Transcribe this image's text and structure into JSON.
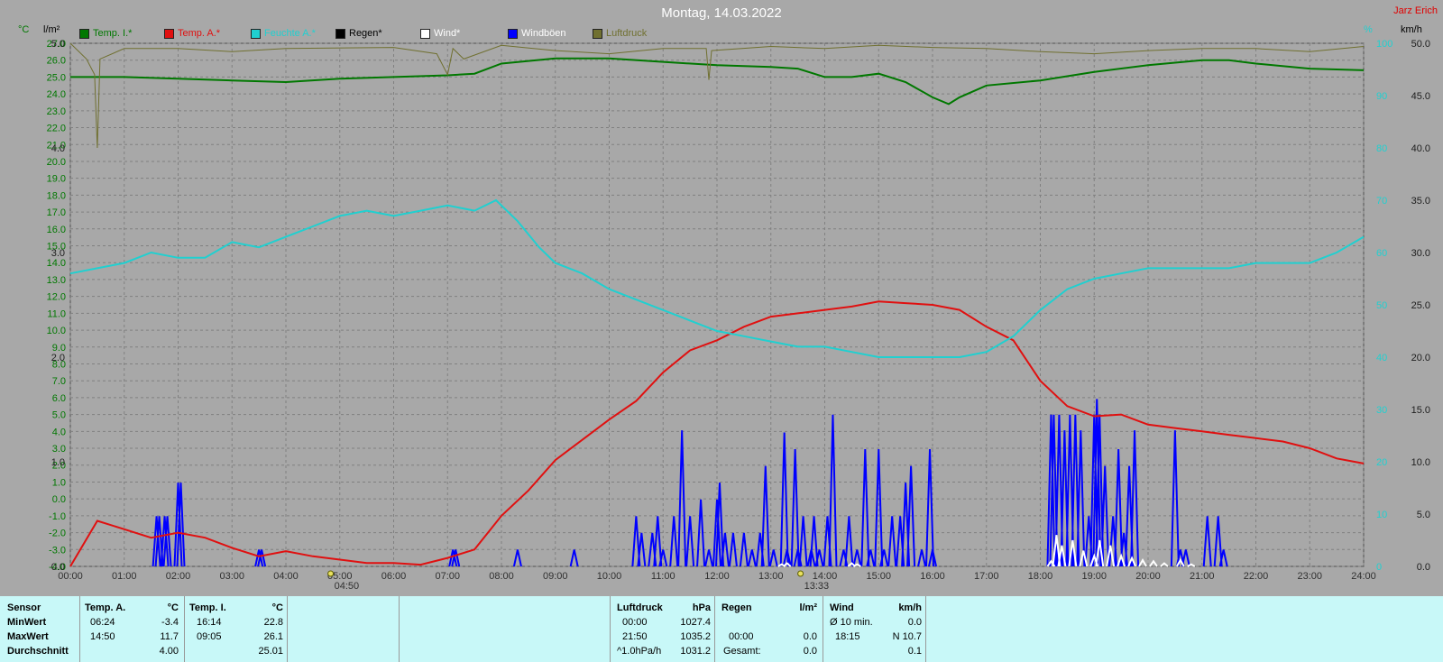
{
  "title": "Montag, 14.03.2022",
  "author": "Jarz Erich",
  "colors": {
    "temp_inside": "#007800",
    "temp_outside": "#e01010",
    "humidity": "#20d0d0",
    "rain": "#000000",
    "wind": "#ffffff",
    "gusts": "#0000ff",
    "pressure": "#707030",
    "axis_left": "#007800",
    "axis_right": "#20d0d0"
  },
  "legend": [
    {
      "label": "Temp. I.*",
      "color": "#007800"
    },
    {
      "label": "Temp. A.*",
      "color": "#e01010"
    },
    {
      "label": "Feuchte A.*",
      "color": "#20d0d0"
    },
    {
      "label": "Regen*",
      "color": "#000000"
    },
    {
      "label": "Wind*",
      "color": "#ffffff"
    },
    {
      "label": "Windböen",
      "color": "#0000ff"
    },
    {
      "label": "Luftdruck",
      "color": "#707030"
    }
  ],
  "units": {
    "temp": "°C",
    "rain": "l/m²",
    "humidity": "%",
    "wind": "km/h"
  },
  "chart_data": {
    "type": "line",
    "title": "Montag, 14.03.2022",
    "x_ticks": [
      "00:00",
      "01:00",
      "02:00",
      "03:00",
      "04:00",
      "05:00",
      "06:00",
      "07:00",
      "08:00",
      "09:00",
      "10:00",
      "11:00",
      "12:00",
      "13:00",
      "14:00",
      "15:00",
      "16:00",
      "17:00",
      "18:00",
      "19:00",
      "20:00",
      "21:00",
      "22:00",
      "23:00",
      "24:00"
    ],
    "x_range": [
      0,
      24
    ],
    "y_temp_ticks": [
      "27.0",
      "26.0",
      "25.0",
      "24.0",
      "23.0",
      "22.0",
      "21.0",
      "20.0",
      "19.0",
      "18.0",
      "17.0",
      "16.0",
      "15.0",
      "14.0",
      "13.0",
      "12.0",
      "11.0",
      "10.0",
      "9.0",
      "8.0",
      "7.0",
      "6.0",
      "5.0",
      "4.0",
      "3.0",
      "2.0",
      "1.0",
      "0.0",
      "-1.0",
      "-2.0",
      "-3.0",
      "-4.0"
    ],
    "y_temp_range": [
      -4,
      27
    ],
    "y_rain_ticks": [
      "5.0",
      "4.0",
      "3.0",
      "2.0",
      "1.0",
      "0.0"
    ],
    "y_rain_range": [
      0,
      5
    ],
    "y_humidity_ticks": [
      "100",
      "90",
      "80",
      "70",
      "60",
      "50",
      "40",
      "30",
      "20",
      "10",
      "0"
    ],
    "y_humidity_range": [
      0,
      100
    ],
    "y_wind_ticks": [
      "50.0",
      "45.0",
      "40.0",
      "35.0",
      "30.0",
      "25.0",
      "20.0",
      "15.0",
      "10.0",
      "5.0",
      "0.0"
    ],
    "y_wind_range": [
      0,
      50
    ],
    "markers": [
      {
        "x": 4.83,
        "label": "04:50",
        "icon": "sunrise-icon"
      },
      {
        "x": 13.55,
        "label": "13:33",
        "icon": "moon-icon"
      }
    ],
    "series": [
      {
        "name": "Temp. I.*",
        "axis": "temp",
        "color": "#007800",
        "x": [
          0,
          1,
          2,
          3,
          4,
          5,
          6,
          7,
          7.5,
          8,
          9,
          10,
          11,
          12,
          13,
          13.5,
          14,
          14.5,
          15,
          15.5,
          16,
          16.3,
          16.5,
          17,
          18,
          19,
          20,
          21,
          21.5,
          22,
          23,
          24
        ],
        "y": [
          25.0,
          25.0,
          24.9,
          24.8,
          24.7,
          24.9,
          25.0,
          25.1,
          25.2,
          25.8,
          26.1,
          26.1,
          25.9,
          25.7,
          25.6,
          25.5,
          25.0,
          25.0,
          25.2,
          24.7,
          23.8,
          23.4,
          23.8,
          24.5,
          24.8,
          25.3,
          25.7,
          26.0,
          26.0,
          25.8,
          25.5,
          25.4
        ]
      },
      {
        "name": "Temp. A.*",
        "axis": "temp",
        "color": "#e01010",
        "x": [
          0,
          0.5,
          1,
          1.5,
          2,
          2.5,
          3,
          3.5,
          4,
          4.5,
          5,
          5.5,
          6,
          6.5,
          7,
          7.5,
          8,
          8.5,
          9,
          9.5,
          10,
          10.5,
          11,
          11.5,
          12,
          12.5,
          13,
          13.5,
          14,
          14.5,
          15,
          15.5,
          16,
          16.5,
          17,
          17.5,
          18,
          18.5,
          19,
          19.5,
          20,
          20.5,
          21,
          21.5,
          22,
          22.5,
          23,
          23.5,
          24
        ],
        "y": [
          -4.0,
          -1.3,
          -1.8,
          -2.3,
          -2.0,
          -2.3,
          -2.9,
          -3.4,
          -3.1,
          -3.4,
          -3.6,
          -3.8,
          -3.8,
          -3.9,
          -3.5,
          -3.0,
          -1.0,
          0.5,
          2.3,
          3.5,
          4.7,
          5.8,
          7.5,
          8.8,
          9.4,
          10.2,
          10.8,
          11.0,
          11.2,
          11.4,
          11.7,
          11.6,
          11.5,
          11.2,
          10.2,
          9.4,
          7.0,
          5.5,
          4.9,
          5.0,
          4.4,
          4.2,
          4.0,
          3.8,
          3.6,
          3.4,
          3.0,
          2.4,
          2.1
        ]
      },
      {
        "name": "Feuchte A.*",
        "axis": "humidity",
        "color": "#20d0d0",
        "x": [
          0,
          0.5,
          1,
          1.5,
          2,
          2.5,
          3,
          3.5,
          4,
          4.5,
          5,
          5.5,
          6,
          6.5,
          7,
          7.5,
          7.9,
          8.3,
          8.7,
          9,
          9.5,
          10,
          10.5,
          11,
          11.5,
          12,
          12.5,
          13,
          13.5,
          14,
          14.5,
          15,
          15.5,
          16,
          16.5,
          17,
          17.5,
          18,
          18.5,
          19,
          19.5,
          20,
          20.5,
          21,
          21.5,
          22,
          22.5,
          23,
          23.5,
          24
        ],
        "y": [
          56,
          57,
          58,
          60,
          59,
          59,
          62,
          61,
          63,
          65,
          67,
          68,
          67,
          68,
          69,
          68,
          70,
          66,
          61,
          58,
          56,
          53,
          51,
          49,
          47,
          45,
          44,
          43,
          42,
          42,
          41,
          40,
          40,
          40,
          40,
          41,
          44,
          49,
          53,
          55,
          56,
          57,
          57,
          57,
          57,
          58,
          58,
          58,
          60,
          63
        ]
      },
      {
        "name": "Luftdruck",
        "axis": "rain",
        "color": "#707030",
        "x": [
          0,
          0.3,
          0.45,
          0.5,
          0.55,
          1,
          2,
          3,
          4,
          6,
          6.8,
          7.0,
          7.1,
          7.3,
          8,
          9,
          10,
          11,
          11.8,
          11.85,
          11.9,
          13,
          14,
          15,
          16,
          17,
          18,
          19,
          20,
          21,
          22,
          23,
          24
        ],
        "y": [
          5.0,
          4.85,
          4.7,
          4.0,
          4.85,
          4.95,
          4.95,
          4.92,
          4.95,
          4.96,
          4.9,
          4.7,
          4.95,
          4.85,
          4.98,
          4.93,
          4.9,
          4.95,
          4.95,
          4.65,
          4.93,
          4.97,
          4.95,
          4.98,
          4.96,
          4.95,
          4.92,
          4.9,
          4.93,
          4.95,
          4.95,
          4.92,
          4.97
        ]
      }
    ],
    "bars": [
      {
        "name": "Windböen",
        "axis": "wind",
        "color": "#0000ff",
        "x": [
          1.6,
          1.65,
          1.75,
          1.8,
          2.0,
          2.05,
          3.5,
          3.55,
          7.1,
          7.15,
          8.3,
          9.35,
          10.5,
          10.6,
          10.8,
          10.9,
          11.0,
          11.2,
          11.35,
          11.5,
          11.7,
          11.85,
          12.0,
          12.05,
          12.15,
          12.3,
          12.5,
          12.65,
          12.8,
          12.9,
          13.05,
          13.25,
          13.3,
          13.45,
          13.5,
          13.6,
          13.75,
          13.8,
          13.9,
          14.05,
          14.15,
          14.35,
          14.45,
          14.6,
          14.75,
          14.85,
          15.0,
          15.1,
          15.25,
          15.4,
          15.5,
          15.6,
          15.8,
          15.95,
          16.0,
          18.2,
          18.25,
          18.35,
          18.45,
          18.55,
          18.65,
          18.75,
          18.9,
          19.0,
          19.05,
          19.1,
          19.2,
          19.35,
          19.45,
          19.55,
          19.65,
          19.75,
          20.5,
          20.6,
          20.7,
          21.1,
          21.3,
          21.4
        ],
        "y": [
          4.8,
          4.8,
          4.8,
          4.8,
          8,
          8,
          1.6,
          1.6,
          1.6,
          1.6,
          1.6,
          1.6,
          4.8,
          3.2,
          3.2,
          4.8,
          1.6,
          4.8,
          13,
          4.8,
          6.4,
          1.6,
          6.4,
          8,
          3.2,
          3.2,
          3.2,
          1.6,
          3.2,
          9.6,
          1.6,
          12.8,
          1.6,
          11.2,
          1.6,
          4.8,
          1.6,
          4.8,
          1.6,
          4.8,
          14.5,
          1.6,
          4.8,
          1.6,
          11.2,
          1.6,
          11.2,
          1.6,
          4.8,
          4.8,
          8,
          9.6,
          1.6,
          11.2,
          1.6,
          14.5,
          14.5,
          14.5,
          13,
          14.5,
          14.5,
          13,
          4.8,
          14.5,
          16,
          14.5,
          9.6,
          4.8,
          11.2,
          3.2,
          9.6,
          13,
          13,
          1.6,
          1.6,
          4.8,
          4.8,
          1.6
        ]
      },
      {
        "name": "Wind*",
        "axis": "wind",
        "color": "#ffffff",
        "x": [
          13.2,
          13.3,
          14.5,
          14.6,
          18.2,
          18.3,
          18.4,
          18.6,
          18.8,
          19.0,
          19.1,
          19.3,
          19.5,
          19.7,
          19.9,
          20.1,
          20.3,
          20.6,
          20.8
        ],
        "y": [
          0.2,
          0.3,
          0.3,
          0.2,
          0.5,
          3.0,
          2.0,
          2.5,
          1.5,
          1.0,
          2.5,
          2.0,
          1.0,
          0.8,
          0.6,
          0.5,
          0.3,
          0.6,
          0.2
        ]
      }
    ]
  },
  "summary": {
    "headers": {
      "sensor": "Sensor",
      "temp_a": "Temp. A.",
      "temp_a_unit": "°C",
      "temp_i": "Temp. I.",
      "temp_i_unit": "°C",
      "pressure": "Luftdruck",
      "pressure_unit": "hPa",
      "rain": "Regen",
      "rain_unit": "l/m²",
      "wind": "Wind",
      "wind_unit": "km/h"
    },
    "rows": [
      "MinWert",
      "MaxWert",
      "Durchschnitt"
    ],
    "temp_a": [
      [
        "06:24",
        "-3.4"
      ],
      [
        "14:50",
        "11.7"
      ],
      [
        "",
        "4.00"
      ]
    ],
    "temp_i": [
      [
        "16:14",
        "22.8"
      ],
      [
        "09:05",
        "26.1"
      ],
      [
        "",
        "25.01"
      ]
    ],
    "pressure": [
      [
        "00:00",
        "1027.4"
      ],
      [
        "21:50",
        "1035.2"
      ],
      [
        "^1.0hPa/h",
        "1031.2"
      ]
    ],
    "rain": [
      [
        "",
        ""
      ],
      [
        "00:00",
        "0.0"
      ],
      [
        "Gesamt:",
        "0.0"
      ]
    ],
    "wind": [
      [
        "Ø 10 min.",
        "0.0"
      ],
      [
        "18:15",
        "N 10.7"
      ],
      [
        "",
        "0.1"
      ]
    ]
  }
}
